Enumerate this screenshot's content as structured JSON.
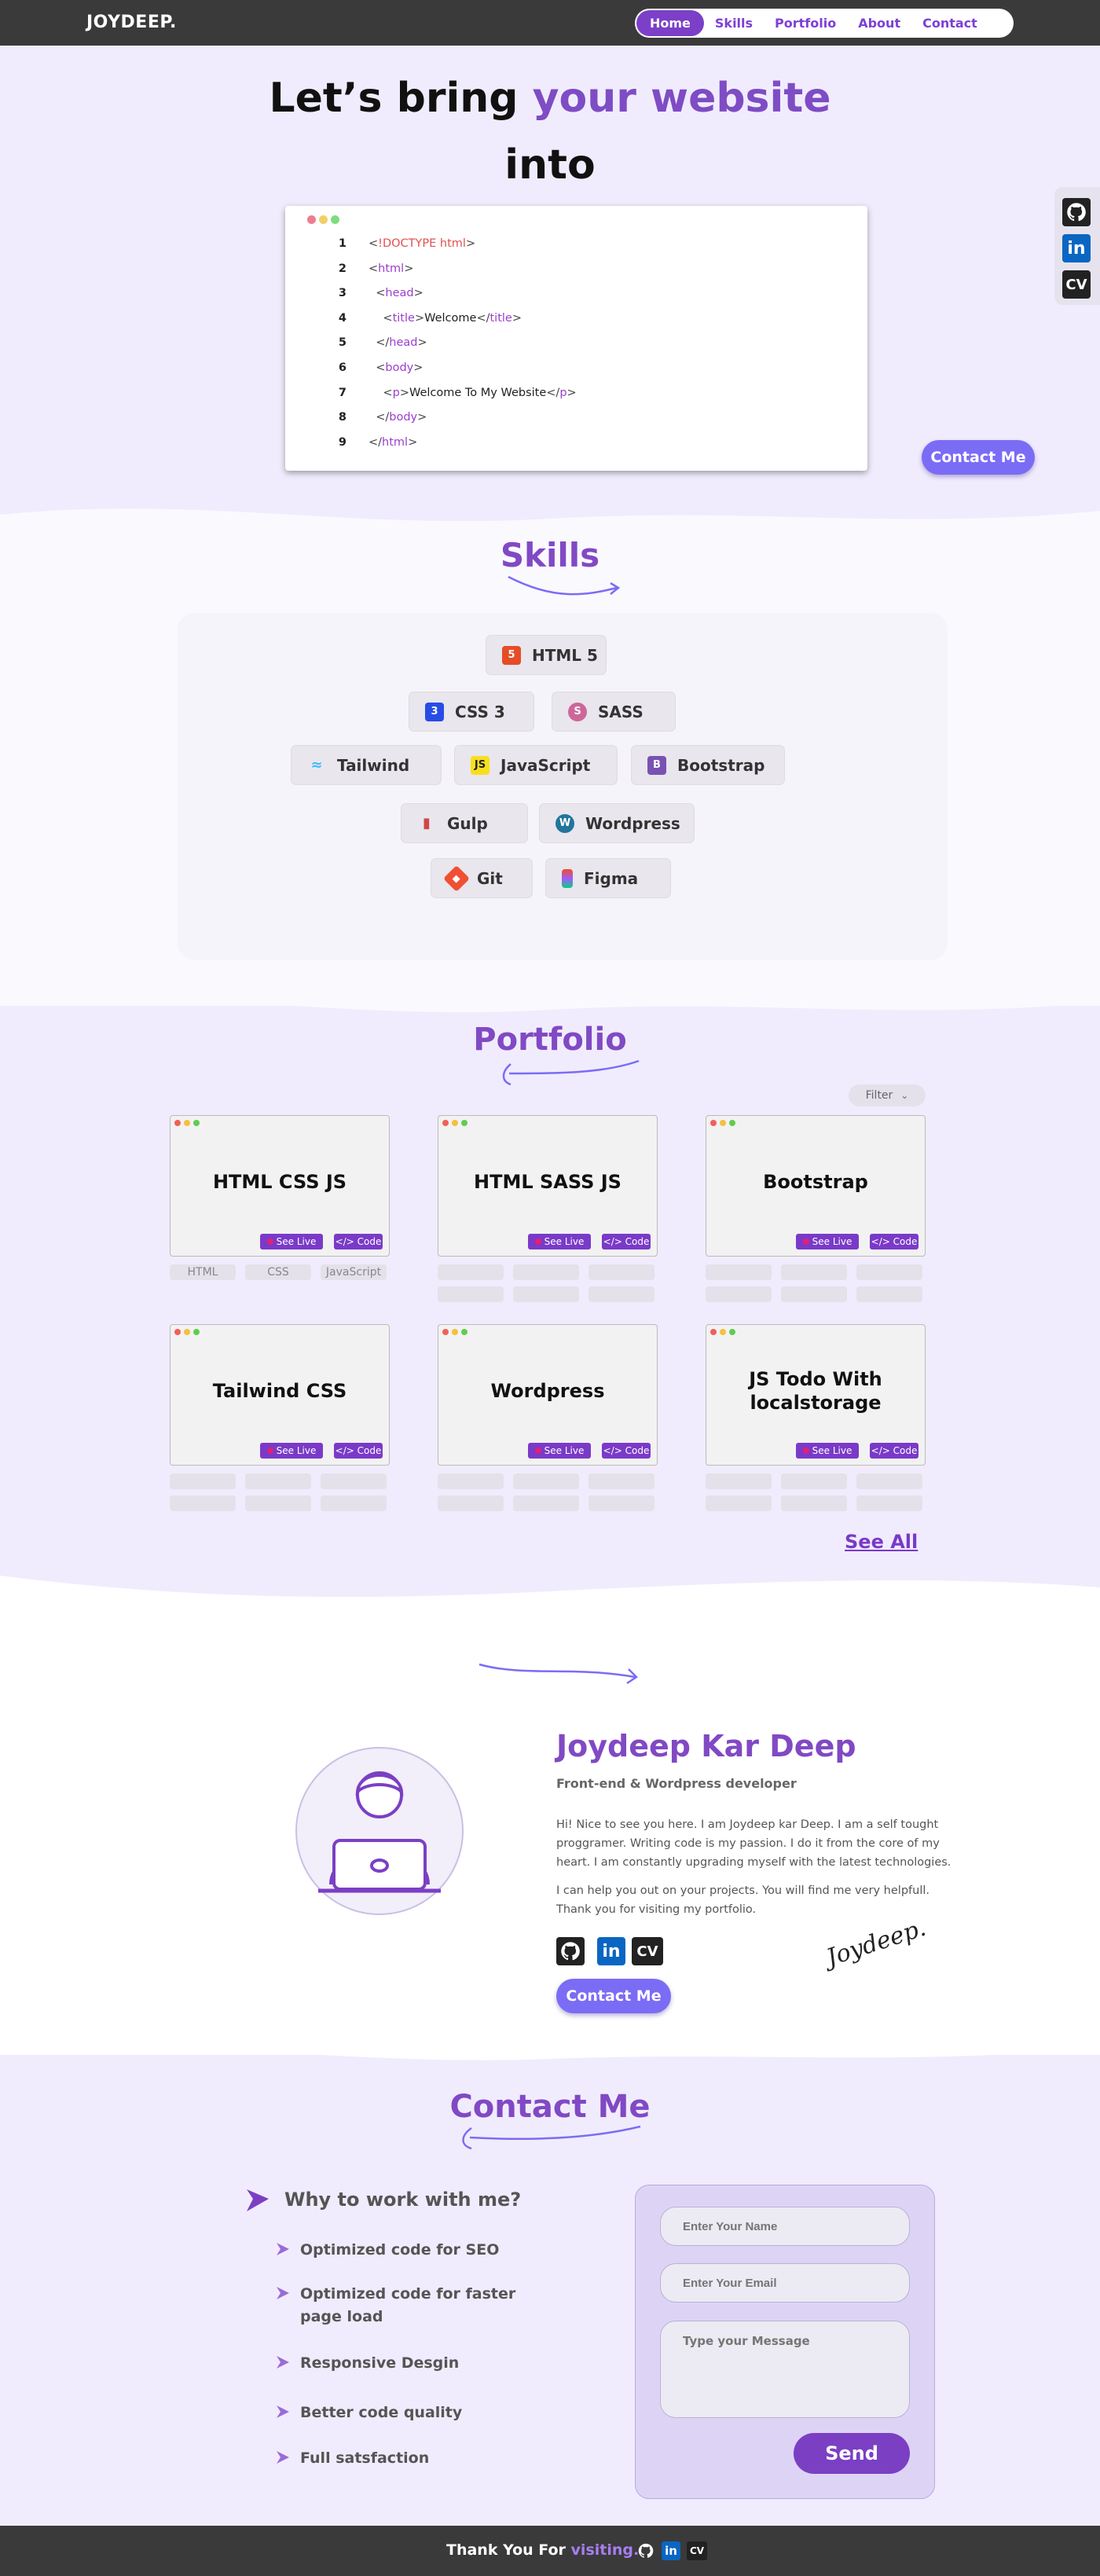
{
  "nav": {
    "logo": "JOYDEEP.",
    "items": [
      {
        "label": "Home",
        "active": true
      },
      {
        "label": "Skills"
      },
      {
        "label": "Portfolio"
      },
      {
        "label": "About"
      },
      {
        "label": "Contact"
      }
    ]
  },
  "hero": {
    "line1_pre": "Let’s bring ",
    "line1_highlight": "your website",
    "line2": "into",
    "code_lines": [
      {
        "n": "1",
        "parts": [
          [
            "br",
            "<"
          ],
          [
            "ex",
            "!DOCTYPE html"
          ],
          [
            "br",
            ">"
          ]
        ]
      },
      {
        "n": "2",
        "parts": [
          [
            "br",
            "<"
          ],
          [
            "tg",
            "html"
          ],
          [
            "br",
            ">"
          ]
        ]
      },
      {
        "n": "3",
        "parts": [
          [
            "br",
            "  <"
          ],
          [
            "tg",
            "head"
          ],
          [
            "br",
            ">"
          ]
        ]
      },
      {
        "n": "4",
        "parts": [
          [
            "br",
            "    <"
          ],
          [
            "tg",
            "title"
          ],
          [
            "br",
            ">"
          ],
          [
            "tx",
            "Welcome"
          ],
          [
            "br",
            "</"
          ],
          [
            "tg",
            "title"
          ],
          [
            "br",
            ">"
          ]
        ]
      },
      {
        "n": "5",
        "parts": [
          [
            "br",
            "  </"
          ],
          [
            "tg",
            "head"
          ],
          [
            "br",
            ">"
          ]
        ]
      },
      {
        "n": "6",
        "parts": [
          [
            "br",
            "  <"
          ],
          [
            "tg",
            "body"
          ],
          [
            "br",
            ">"
          ]
        ]
      },
      {
        "n": "7",
        "parts": [
          [
            "br",
            "    <"
          ],
          [
            "tg",
            "p"
          ],
          [
            "br",
            ">"
          ],
          [
            "tx",
            "Welcome To My Website"
          ],
          [
            "br",
            "</"
          ],
          [
            "tg",
            "p"
          ],
          [
            "br",
            ">"
          ]
        ]
      },
      {
        "n": "8",
        "parts": [
          [
            "br",
            "  </"
          ],
          [
            "tg",
            "body"
          ],
          [
            "br",
            ">"
          ]
        ]
      },
      {
        "n": "9",
        "parts": [
          [
            "br",
            "</"
          ],
          [
            "tg",
            "html"
          ],
          [
            "br",
            ">"
          ]
        ]
      }
    ],
    "contact_button": "Contact Me"
  },
  "social": {
    "cv_label": "CV"
  },
  "skills": {
    "title": "Skills",
    "items": [
      "HTML 5",
      "CSS 3",
      "SASS",
      "Tailwind",
      "JavaScript",
      "Bootstrap",
      "Gulp",
      "Wordpress",
      "Git",
      "Figma"
    ]
  },
  "portfolio": {
    "title": "Portfolio",
    "filter": "Filter",
    "see_live": "See Live",
    "code": "</> Code",
    "cards": [
      "HTML CSS JS",
      "HTML  SASS JS",
      "Bootstrap",
      "Tailwind CSS",
      "Wordpress",
      "JS Todo With localstorage"
    ],
    "first_tags": [
      "HTML",
      "CSS",
      "JavaScript"
    ],
    "see_all": "See All"
  },
  "about": {
    "name": "Joydeep Kar Deep",
    "role": "Front-end & Wordpress developer",
    "p1": "Hi! Nice to see you here. I am Joydeep kar Deep. I am a self tought proggramer. Writing code is my passion. I do it from the core of my heart. I am constantly upgrading myself with the latest technologies.",
    "p2": "I can help you out on your projects. You will find me very helpfull. Thank you for visiting my portfolio.",
    "signature": "Joydeep.",
    "contact_button": "Contact Me"
  },
  "contact": {
    "title": "Contact Me",
    "why_title": "Why to work with me?",
    "reasons": [
      "Optimized code for SEO",
      "Optimized code for faster page load",
      "Responsive Desgin",
      "Better code quality",
      "Full satsfaction"
    ],
    "name_placeholder": "Enter Your Name",
    "email_placeholder": "Enter Your Email",
    "message_placeholder": "Type your Message",
    "send": "Send"
  },
  "footer": {
    "text": "Thank You For ",
    "highlight": "visiting."
  },
  "colors": {
    "accent": "#8149c4",
    "button": "#7b6cf5",
    "nav_bg": "#3a3a3a"
  }
}
